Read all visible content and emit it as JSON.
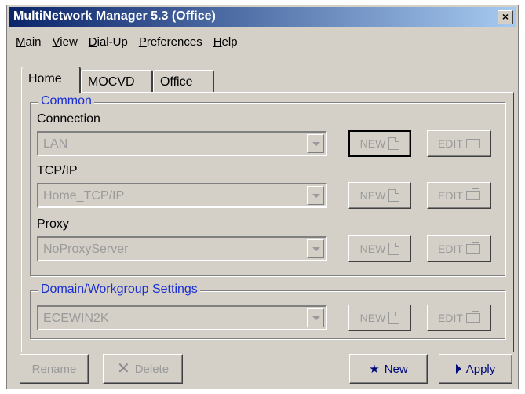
{
  "window": {
    "title": "MultiNetwork Manager 5.3 (Office)",
    "close_label": "×"
  },
  "menu": [
    {
      "label": "Main"
    },
    {
      "label": "View"
    },
    {
      "label": "Dial-Up"
    },
    {
      "label": "Preferences"
    },
    {
      "label": "Help"
    }
  ],
  "tabs": [
    {
      "label": "Home",
      "active": true
    },
    {
      "label": "MOCVD",
      "active": false
    },
    {
      "label": "Office",
      "active": false
    }
  ],
  "common": {
    "legend": "Common",
    "connection": {
      "label": "Connection",
      "value": "LAN"
    },
    "tcpip": {
      "label": "TCP/IP",
      "value": "Home_TCP/IP"
    },
    "proxy": {
      "label": "Proxy",
      "value": "NoProxyServer"
    }
  },
  "domain": {
    "legend": "Domain/Workgroup Settings",
    "value": "ECEWIN2K"
  },
  "buttons": {
    "new_label": "NEW",
    "edit_label": "EDIT"
  },
  "footer": {
    "rename_label": "Rename",
    "delete_label": "Delete",
    "new_label": "New",
    "apply_label": "Apply"
  },
  "colors": {
    "title_start": "#0a246a",
    "title_end": "#a6caf0",
    "legend": "#1a2fd0",
    "accent_text": "#000a7a"
  },
  "icons": {
    "close": "close-icon",
    "new": "new-document-icon",
    "edit": "open-folder-icon",
    "delete": "x-icon",
    "new_profile": "star-icon",
    "apply": "play-arrow-icon"
  }
}
